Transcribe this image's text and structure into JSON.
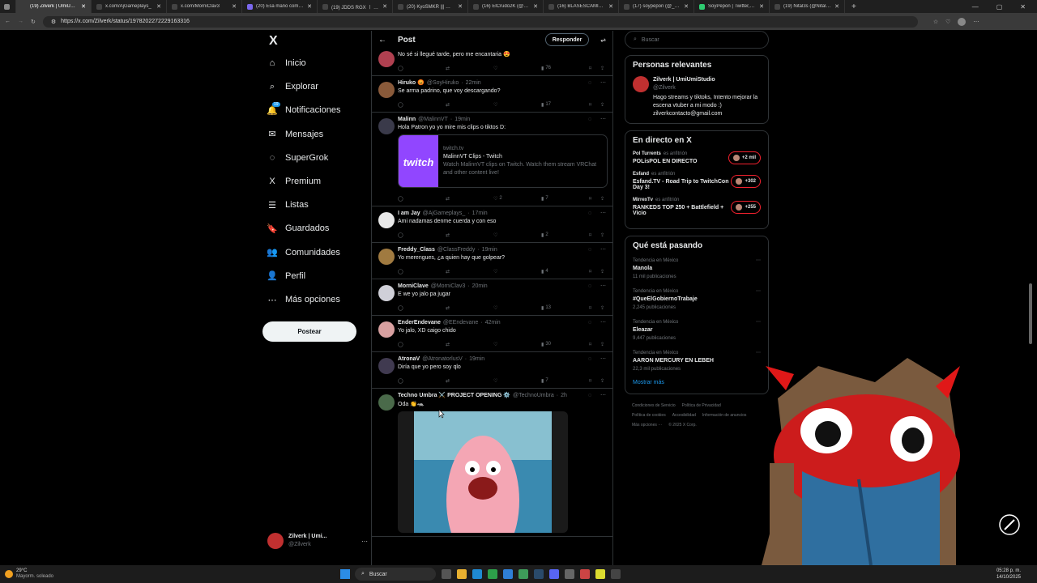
{
  "browser": {
    "tabs": [
      {
        "title": "(19) Zilverk | UmiUmiStudio",
        "color": "#3a3a3a"
      },
      {
        "title": "x.com/AjGameplays_",
        "color": "#444"
      },
      {
        "title": "x.com/MorniClav3",
        "color": "#444"
      },
      {
        "title": "(20) Esa mano compa - Twi",
        "color": "#7b68ee"
      },
      {
        "title": "(19) JDDS RGX 〡 Editor & Str",
        "color": "#444"
      },
      {
        "title": "(20) KyoSMKR ||| ⚡SHINI",
        "color": "#444"
      },
      {
        "title": "(16) ElCrudo2K (@ElCrudo",
        "color": "#444"
      },
      {
        "title": "(16) BLASESCAMILLA (@bla",
        "color": "#444"
      },
      {
        "title": "(17) soypepon (@_SoyPepo",
        "color": "#444"
      },
      {
        "title": "SoyPepon | Twitter, Instagr",
        "color": "#2ecc71"
      },
      {
        "title": "(19) Nital3s (@Nital3sYT) /",
        "color": "#444"
      }
    ],
    "new_tab": "+",
    "url": "https://x.com/Zilverk/status/1978202272229163316"
  },
  "nav": {
    "logo": "X",
    "items": [
      {
        "label": "Inicio",
        "icon": "home-icon",
        "glyph": "⌂"
      },
      {
        "label": "Explorar",
        "icon": "search-icon",
        "glyph": "⌕"
      },
      {
        "label": "Notificaciones",
        "icon": "bell-icon",
        "glyph": "🔔",
        "badge": "19"
      },
      {
        "label": "Mensajes",
        "icon": "mail-icon",
        "glyph": "✉"
      },
      {
        "label": "SuperGrok",
        "icon": "grok-icon",
        "glyph": "◌"
      },
      {
        "label": "Premium",
        "icon": "x-premium-icon",
        "glyph": "X"
      },
      {
        "label": "Listas",
        "icon": "list-icon",
        "glyph": "☰"
      },
      {
        "label": "Guardados",
        "icon": "bookmark-icon",
        "glyph": "🔖"
      },
      {
        "label": "Comunidades",
        "icon": "communities-icon",
        "glyph": "👥"
      },
      {
        "label": "Perfil",
        "icon": "profile-icon",
        "glyph": "👤"
      },
      {
        "label": "Más opciones",
        "icon": "more-options-icon",
        "glyph": "⋯"
      }
    ],
    "post_label": "Postear",
    "account_name": "Zilverk | Umi...",
    "account_handle": "@Zilverk",
    "account_more": "···"
  },
  "feed": {
    "title": "Post",
    "reply_label": "Responder",
    "tweets": [
      {
        "name": "",
        "handle": "",
        "time": "",
        "text": "No sé si llegué tarde, pero me encantaria 😍",
        "views": "76",
        "avatar_color": "#b04050"
      },
      {
        "name": "Hiruko 😡",
        "handle": "@SoyHiruko",
        "time": "22min",
        "text": "Se arma padrino, que voy descargando?",
        "views": "17",
        "avatar_color": "#8a5a3a"
      },
      {
        "name": "Malinn",
        "handle": "@MalinnVT",
        "time": "19min",
        "text": "Hola Patron yo yo mire mis clips o tiktos D:",
        "views": "7",
        "retweets": "",
        "likes": "2",
        "avatar_color": "#3a3a4a",
        "card": {
          "domain": "twitch.tv",
          "title": "MalinnVT Clips - Twitch",
          "desc": "Watch MalinnVT clips on Twitch. Watch them stream VRChat and other content live!",
          "logo": "twitch"
        }
      },
      {
        "name": "I am Jay",
        "handle": "@AjGameplays_",
        "time": "17min",
        "text": "Ami nadamas denme cuerda y con eso",
        "views": "2",
        "avatar_color": "#e8e8e8"
      },
      {
        "name": "Freddy_Class",
        "handle": "@ClassFreddy",
        "time": "19min",
        "text": "Yo merengues, ¿a quien hay que golpear?",
        "views": "4",
        "avatar_color": "#a07a40"
      },
      {
        "name": "MorniClave",
        "handle": "@MorniClav3",
        "time": "20min",
        "text": "E we yo jalo pa jugar",
        "views": "13",
        "avatar_color": "#d0d0d8"
      },
      {
        "name": "EnderEndevane",
        "handle": "@EEndevane",
        "time": "42min",
        "text": "Yo jalo, XD caigo chido",
        "views": "30",
        "avatar_color": "#d8a0a0"
      },
      {
        "name": "AtronaV",
        "handle": "@AtronatorlusV",
        "time": "19min",
        "text": "Diría que yo pero soy qlo",
        "views": "7",
        "avatar_color": "#403a50"
      },
      {
        "name": "Techno Umbra ⚔️ PROJECT OPENING ⚙️",
        "handle": "@TechnoUmbra",
        "time": "2h",
        "text": "Oda 👏🦡",
        "views": "",
        "avatar_color": "#4a6a4a",
        "gif": true
      }
    ]
  },
  "right": {
    "search_placeholder": "Buscar",
    "relevant_title": "Personas relevantes",
    "person": {
      "name": "Zilverk | UmiUmiStudio",
      "handle": "@Zilverk",
      "bio": "Hago streams y tiktoks, Intento mejorar la escena vtuber a mi modo :) zilverkcontacto@gmail.com"
    },
    "live_title": "En directo en X",
    "live": [
      {
        "host": "Pol Turrents",
        "role": "es anfitrión",
        "title": "POLisPOL EN DIRECTO",
        "count": "+2 mil"
      },
      {
        "host": "Esfand",
        "role": "es anfitrión",
        "title": "Esfand.TV - Road Trip to TwitchCon Day 3!",
        "count": "+302"
      },
      {
        "host": "MirrexTv",
        "role": "es anfitrión",
        "title": "RANKEDS TOP 250 + Battlefield + Vicio",
        "count": "+255"
      }
    ],
    "trends_title": "Qué está pasando",
    "trends": [
      {
        "context": "Tendencia en México",
        "name": "Manola",
        "count": "11 mil publicaciones"
      },
      {
        "context": "Tendencia en México",
        "name": "#QueElGobiernoTrabaje",
        "count": "2,245 publicaciones"
      },
      {
        "context": "Tendencia en México",
        "name": "Eleazar",
        "count": "9,447 publicaciones"
      },
      {
        "context": "Tendencia en México",
        "name": "AARON MERCURY EN LEBEH",
        "count": "22,3 mil publicaciones"
      }
    ],
    "show_more": "Mostrar más",
    "footer": [
      "Condiciones de Servicio",
      "Política de Privacidad",
      "Política de cookies",
      "Accesibilidad",
      "Información de anuncios",
      "Más opciones ···",
      "© 2025 X Corp."
    ]
  },
  "taskbar": {
    "temp": "29°C",
    "weather": "Mayorm. soleado",
    "search": "Buscar",
    "time": "05:28 p. m.",
    "date": "14/10/2025"
  }
}
